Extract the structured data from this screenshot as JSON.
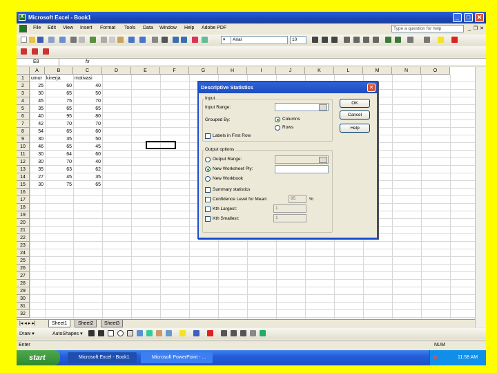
{
  "window": {
    "title": "Microsoft Excel - Book1",
    "min": "_",
    "max": "□",
    "close": "✕"
  },
  "menubar": {
    "items": [
      "File",
      "Edit",
      "View",
      "Insert",
      "Format",
      "Tools",
      "Data",
      "Window",
      "Help",
      "Adobe PDF"
    ],
    "help_placeholder": "Type a question for help",
    "mdi_min": "_",
    "mdi_restore": "❐",
    "mdi_close": "✕"
  },
  "toolbar": {
    "font": "Arial",
    "size": "10",
    "zoom_arrow": "▾"
  },
  "formula_bar": {
    "name_box": "E8",
    "fx": "fx"
  },
  "columns": [
    "A",
    "B",
    "C",
    "D",
    "E",
    "F",
    "G",
    "H",
    "I",
    "J",
    "K",
    "L",
    "M",
    "N",
    "O"
  ],
  "rows": [
    "1",
    "2",
    "3",
    "4",
    "5",
    "6",
    "7",
    "8",
    "9",
    "10",
    "11",
    "12",
    "13",
    "14",
    "15",
    "16",
    "17",
    "18",
    "19",
    "20",
    "21",
    "22",
    "23",
    "24",
    "25",
    "26",
    "27",
    "28",
    "29",
    "30",
    "31",
    "32"
  ],
  "sheet": {
    "headers": [
      "umur",
      "kinerja",
      "motivasi"
    ],
    "data": [
      [
        "25",
        "60",
        "40"
      ],
      [
        "30",
        "65",
        "50"
      ],
      [
        "45",
        "75",
        "70"
      ],
      [
        "35",
        "65",
        "65"
      ],
      [
        "40",
        "95",
        "80"
      ],
      [
        "42",
        "70",
        "70"
      ],
      [
        "54",
        "65",
        "60"
      ],
      [
        "30",
        "35",
        "50"
      ],
      [
        "46",
        "65",
        "45"
      ],
      [
        "30",
        "64",
        "60"
      ],
      [
        "30",
        "70",
        "40"
      ],
      [
        "35",
        "63",
        "62"
      ],
      [
        "27",
        "45",
        "35"
      ],
      [
        "30",
        "75",
        "65"
      ]
    ]
  },
  "sheet_tabs": [
    "Sheet1",
    "Sheet2",
    "Sheet3"
  ],
  "drawbar": {
    "draw": "Draw ▾",
    "autoshapes": "AutoShapes ▾"
  },
  "status": {
    "left": "Enter",
    "right": "NUM"
  },
  "taskbar": {
    "start": "start",
    "tasks": [
      "Microsoft Excel - Book1",
      "Microsoft PowerPoint - ..."
    ],
    "time": "11:58 AM"
  },
  "dialog": {
    "title": "Descriptive Statistics",
    "close": "✕",
    "input_group": "Input",
    "input_range": "Input Range:",
    "grouped_by": "Grouped By:",
    "columns": "Columns",
    "rows": "Rows",
    "labels_first_row": "Labels in First Row",
    "output_group": "Output options",
    "output_range": "Output Range:",
    "new_worksheet": "New Worksheet Ply:",
    "new_workbook": "New Workbook",
    "summary": "Summary statistics",
    "confidence": "Confidence Level for Mean:",
    "confidence_value": "95",
    "percent": "%",
    "kth_largest": "Kth Largest:",
    "kth_largest_value": "1",
    "kth_smallest": "Kth Smallest:",
    "kth_smallest_value": "1",
    "ok": "OK",
    "cancel": "Cancel",
    "help": "Help"
  }
}
